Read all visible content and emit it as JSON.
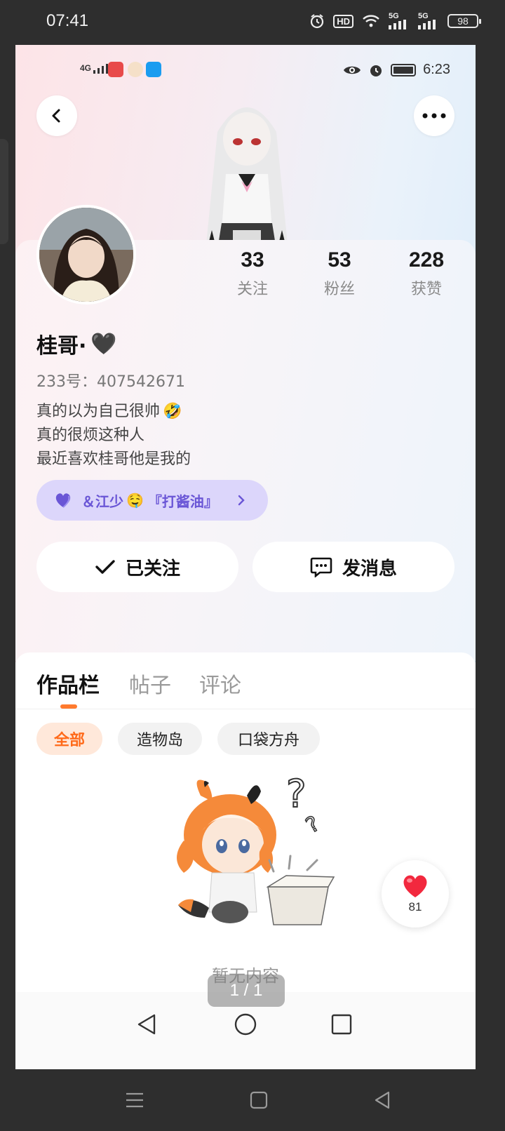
{
  "outer_status": {
    "time": "07:41",
    "network1": "5G",
    "network2": "5G",
    "battery": "98",
    "hd": "HD"
  },
  "inner_status": {
    "signal": "4G",
    "time": "6:23"
  },
  "profile": {
    "nickname": "桂哥·",
    "nickname_emoji": "🖤",
    "uid": "233号：407542671",
    "bio": [
      "真的以为自己很帅",
      "真的很烦这种人",
      "最近喜欢桂哥他是我的"
    ],
    "bio_emoji": "🤣",
    "stats": [
      {
        "num": "33",
        "label": "关注"
      },
      {
        "num": "53",
        "label": "粉丝"
      },
      {
        "num": "228",
        "label": "获赞"
      }
    ],
    "cp_label": "＆江少",
    "cp_emoji": "🤤",
    "cp_suffix": "『打酱油』",
    "follow_label": "已关注",
    "message_label": "发消息"
  },
  "tabs": [
    "作品栏",
    "帖子",
    "评论"
  ],
  "chips": [
    "全部",
    "造物岛",
    "口袋方舟"
  ],
  "empty_text": "暂无内容",
  "like_count": "81",
  "page_indicator": "1 / 1",
  "colors": {
    "accent": "#ff7a2e",
    "cp_purple": "#6a56d6"
  }
}
